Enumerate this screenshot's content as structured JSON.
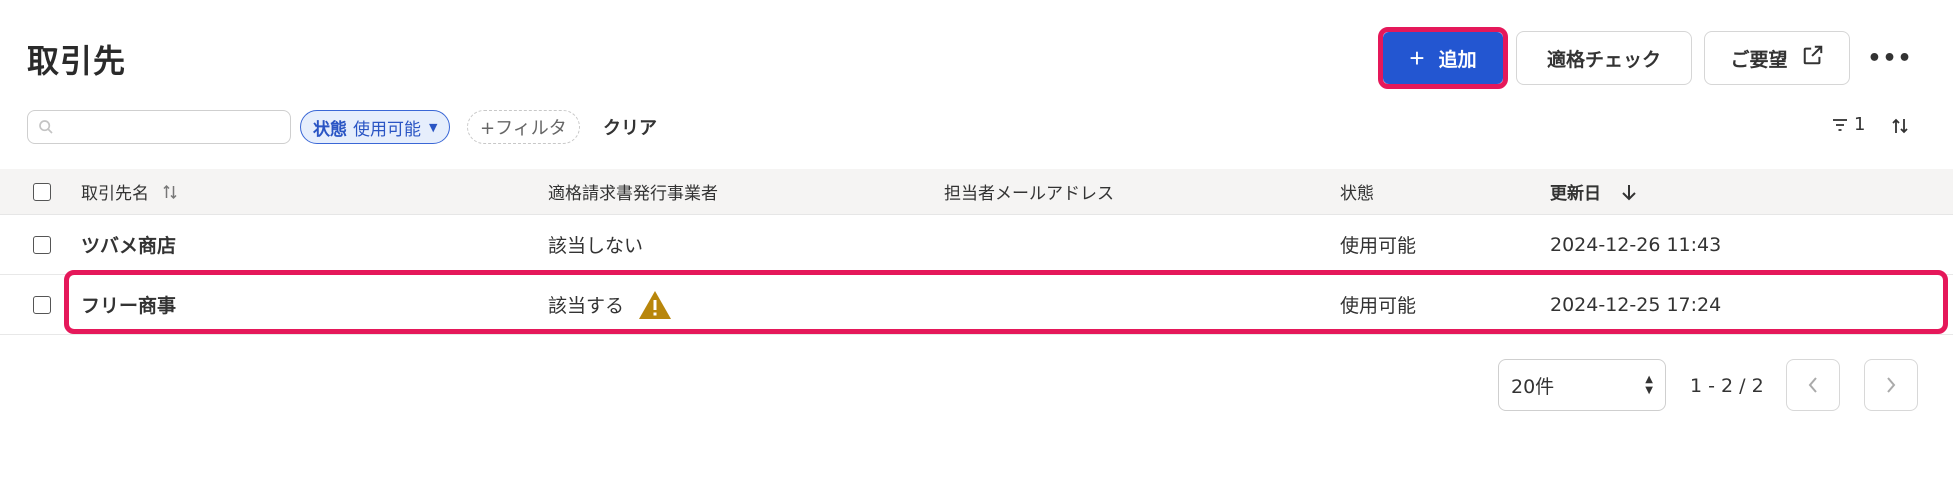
{
  "header": {
    "title": "取引先",
    "add_label": "追加",
    "add_plus": "+",
    "check_label": "適格チェック",
    "request_label": "ご要望",
    "more_label": "•••"
  },
  "filters": {
    "search_placeholder": "",
    "status_key": "状態",
    "status_value": "使用可能",
    "add_filter_label": "+フィルタ",
    "clear_label": "クリア",
    "filter_count": "1"
  },
  "table": {
    "columns": {
      "name": "取引先名",
      "invoice": "適格請求書発行事業者",
      "email": "担当者メールアドレス",
      "status": "状態",
      "updated": "更新日"
    },
    "rows": [
      {
        "name": "ツバメ商店",
        "invoice": "該当しない",
        "email": "",
        "status": "使用可能",
        "updated": "2024-12-26 11:43"
      },
      {
        "name": "フリー商事",
        "invoice": "該当する",
        "email": "",
        "status": "使用可能",
        "updated": "2024-12-25 17:24"
      }
    ]
  },
  "pagination": {
    "per_page": "20件",
    "range": "1 - 2 / 2"
  },
  "colors": {
    "primary": "#2356d1",
    "highlight": "#e5185a",
    "warning": "#b8860b"
  }
}
